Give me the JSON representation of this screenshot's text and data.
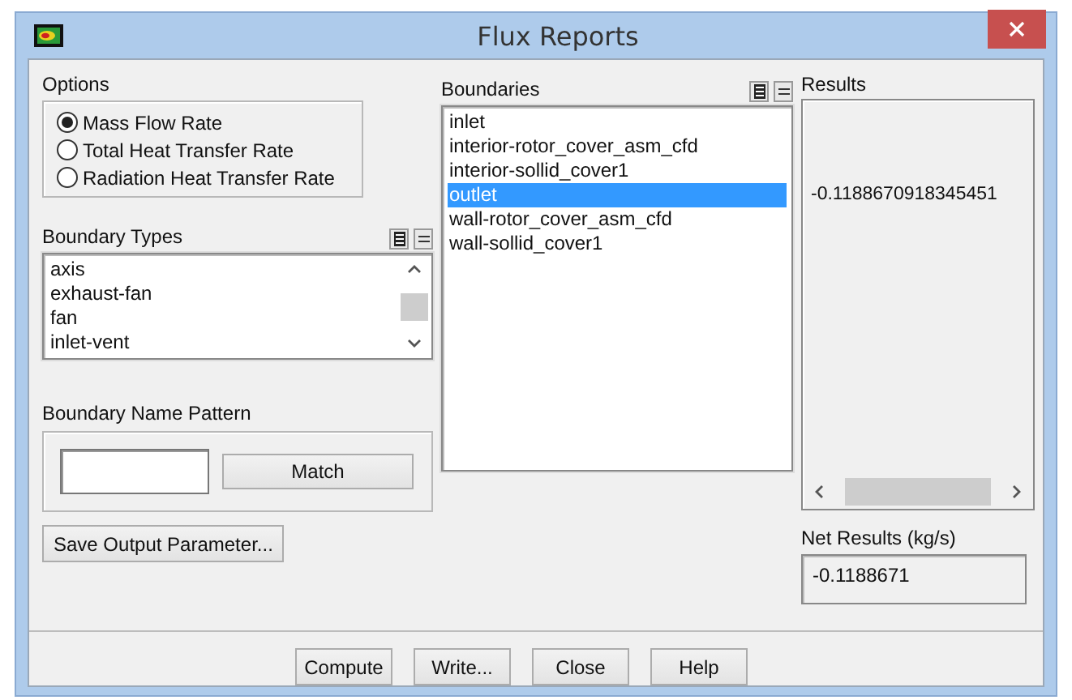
{
  "window": {
    "title": "Flux Reports"
  },
  "options": {
    "label": "Options",
    "items": [
      {
        "label": "Mass Flow Rate",
        "selected": true
      },
      {
        "label": "Total Heat Transfer Rate",
        "selected": false
      },
      {
        "label": "Radiation Heat Transfer Rate",
        "selected": false
      }
    ]
  },
  "boundary_types": {
    "label": "Boundary Types",
    "items": [
      "axis",
      "exhaust-fan",
      "fan",
      "inlet-vent"
    ]
  },
  "name_pattern": {
    "label": "Boundary Name Pattern",
    "button": "Match"
  },
  "save_button": "Save Output Parameter...",
  "boundaries": {
    "label": "Boundaries",
    "items": [
      {
        "label": "inlet",
        "selected": false
      },
      {
        "label": "interior-rotor_cover_asm_cfd",
        "selected": false
      },
      {
        "label": "interior-sollid_cover1",
        "selected": false
      },
      {
        "label": "outlet",
        "selected": true
      },
      {
        "label": "wall-rotor_cover_asm_cfd",
        "selected": false
      },
      {
        "label": "wall-sollid_cover1",
        "selected": false
      }
    ]
  },
  "results": {
    "label": "Results",
    "lines": [
      "-0.1188670918345451"
    ]
  },
  "net_results": {
    "label": "Net Results (kg/s)",
    "value": "-0.1188671"
  },
  "buttons": [
    "Compute",
    "Write...",
    "Close",
    "Help"
  ]
}
